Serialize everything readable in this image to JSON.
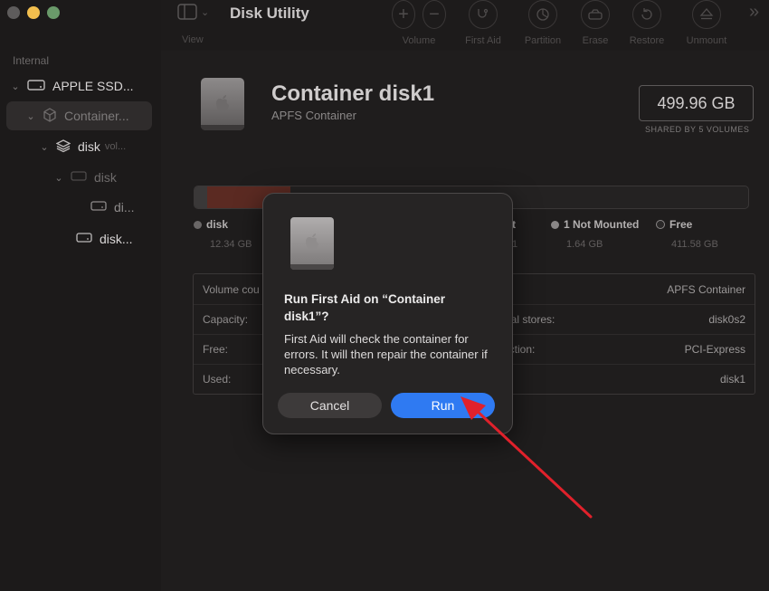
{
  "window": {
    "title": "Disk Utility"
  },
  "toolbar": {
    "view_label": "View",
    "tools": [
      {
        "label": "Volume"
      },
      {
        "label": "First Aid"
      },
      {
        "label": "Partition"
      },
      {
        "label": "Erase"
      },
      {
        "label": "Restore"
      },
      {
        "label": "Unmount"
      }
    ]
  },
  "sidebar": {
    "section": "Internal",
    "items": [
      {
        "label": "APPLE SSD..."
      },
      {
        "label": "Container..."
      },
      {
        "label": "disk",
        "sub": "vol..."
      },
      {
        "label": "disk"
      },
      {
        "label": "di..."
      },
      {
        "label": "disk..."
      }
    ]
  },
  "container": {
    "name": "Container disk1",
    "type": "APFS Container",
    "capacity": "499.96 GB",
    "shared": "SHARED BY 5 VOLUMES"
  },
  "legend": [
    {
      "label": "disk",
      "size": "12.34 GB",
      "color": "#6a6767"
    },
    {
      "label": "t",
      "size": "1",
      "color": "#6a6767"
    },
    {
      "label": "1 Not Mounted",
      "size": "1.64 GB",
      "color": "#8a8787"
    },
    {
      "label": "Free",
      "size": "411.58 GB",
      "color": "#2a2828"
    }
  ],
  "info": {
    "rows": [
      {
        "key": "Volume cou",
        "key2": "",
        "value": "APFS Container"
      },
      {
        "key": "Capacity:",
        "key2": "ical stores:",
        "value": "disk0s2"
      },
      {
        "key": "Free:",
        "key2": "ection:",
        "value": "PCI-Express"
      },
      {
        "key": "Used:",
        "key2": "e:",
        "value": "disk1"
      }
    ]
  },
  "dialog": {
    "title": "Run First Aid on “Container disk1”?",
    "body": "First Aid will check the container for errors. It will then repair the container if necessary.",
    "cancel_label": "Cancel",
    "run_label": "Run"
  },
  "colors": {
    "accent": "#2f7af2",
    "arrow": "#e0212b"
  }
}
